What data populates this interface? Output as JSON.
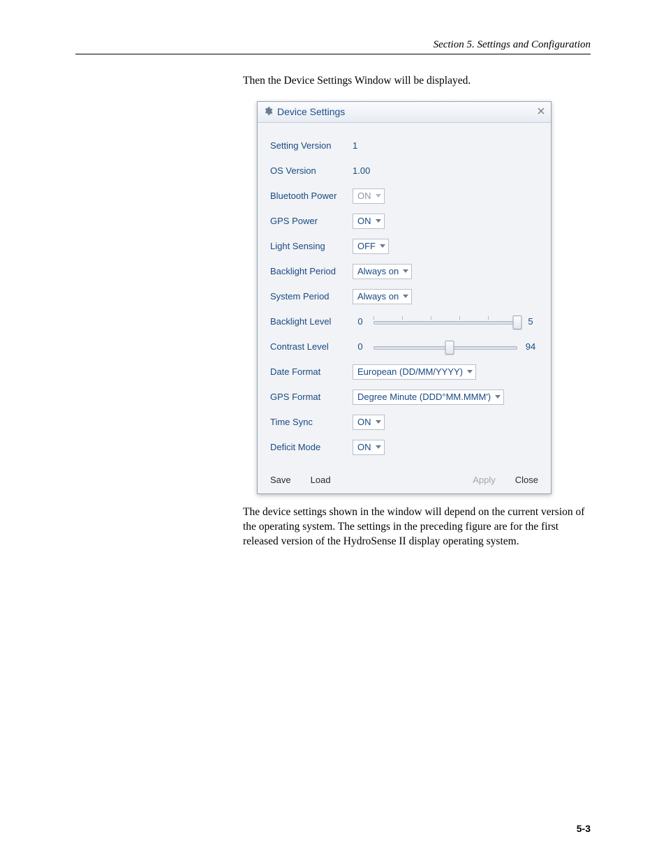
{
  "header": {
    "section": "Section 5.  Settings and Configuration",
    "page_number": "5-3"
  },
  "text": {
    "intro": "Then the Device Settings Window will be displayed.",
    "outro": "The device settings shown in the window will depend on the current version of the operating system.  The settings in the preceding figure are for the first released version of the HydroSense II display operating system."
  },
  "dialog": {
    "title": "Device Settings",
    "rows": {
      "setting_version": {
        "label": "Setting Version",
        "value": "1"
      },
      "os_version": {
        "label": "OS Version",
        "value": "1.00"
      },
      "bluetooth_power": {
        "label": "Bluetooth Power",
        "value": "ON",
        "enabled": false
      },
      "gps_power": {
        "label": "GPS Power",
        "value": "ON",
        "enabled": true
      },
      "light_sensing": {
        "label": "Light Sensing",
        "value": "OFF",
        "enabled": true
      },
      "backlight_period": {
        "label": "Backlight Period",
        "value": "Always on",
        "enabled": true
      },
      "system_period": {
        "label": "System Period",
        "value": "Always on",
        "enabled": true
      },
      "backlight_level": {
        "label": "Backlight Level",
        "min": "0",
        "max": "5",
        "value": 5,
        "ticks": 6
      },
      "contrast_level": {
        "label": "Contrast Level",
        "min": "0",
        "max": "94",
        "value": 50,
        "ticks": 0
      },
      "date_format": {
        "label": "Date Format",
        "value": "European (DD/MM/YYYY)",
        "enabled": true
      },
      "gps_format": {
        "label": "GPS Format",
        "value": "Degree Minute (DDD°MM.MMM')",
        "enabled": true
      },
      "time_sync": {
        "label": "Time Sync",
        "value": "ON",
        "enabled": true
      },
      "deficit_mode": {
        "label": "Deficit Mode",
        "value": "ON",
        "enabled": true
      }
    },
    "buttons": {
      "save": "Save",
      "load": "Load",
      "apply": "Apply",
      "close": "Close"
    }
  }
}
